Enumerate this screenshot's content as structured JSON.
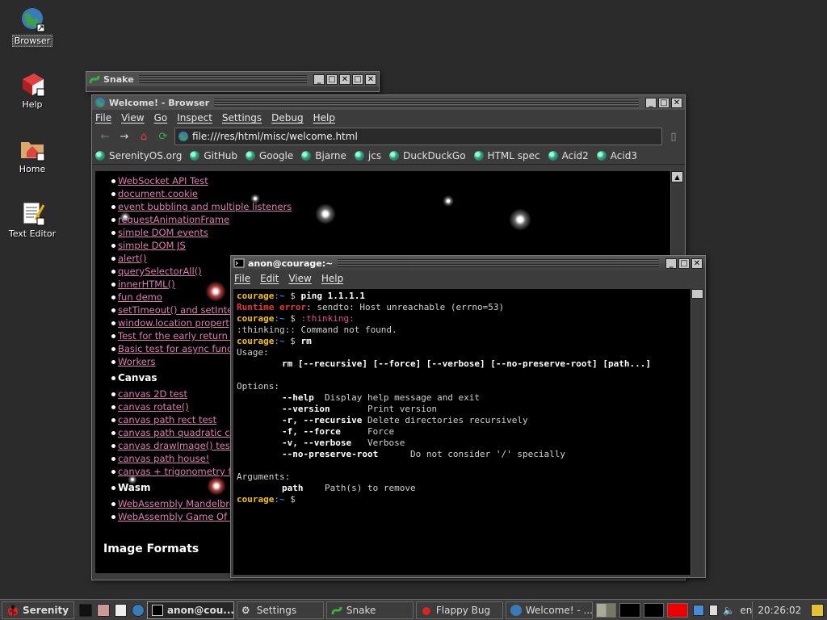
{
  "desktop": {
    "icons": [
      {
        "label": "Browser"
      },
      {
        "label": "Help"
      },
      {
        "label": "Home"
      },
      {
        "label": "Text Editor"
      }
    ]
  },
  "snake_window": {
    "title": "Snake"
  },
  "browser": {
    "title": "Welcome! - Browser",
    "menu": [
      "File",
      "View",
      "Go",
      "Inspect",
      "Settings",
      "Debug",
      "Help"
    ],
    "url": "file:///res/html/misc/welcome.html",
    "bookmarks": [
      "SerenityOS.org",
      "GitHub",
      "Google",
      "Bjarne",
      "jcs",
      "DuckDuckGo",
      "HTML spec",
      "Acid2",
      "Acid3"
    ],
    "links_group1": [
      "WebSocket API Test",
      "document.cookie",
      "event bubbling and multiple listeners",
      "requestAnimationFrame",
      "simple DOM events",
      "simple DOM JS",
      "alert()",
      "querySelectorAll()",
      "innerHTML()",
      "fun demo",
      "setTimeout() and setInter",
      "window.location property",
      "Test for the early return s",
      "Basic test for async func",
      "Workers"
    ],
    "heading_canvas": "Canvas",
    "links_group2": [
      "canvas 2D test",
      "canvas rotate()",
      "canvas path rect test",
      "canvas path quadratic cu",
      "canvas drawImage() test",
      "canvas path house!",
      "canvas + trigonometry fun"
    ],
    "heading_wasm": "Wasm",
    "links_group3": [
      "WebAssembly Mandelbrot",
      "WebAssembly Game Of Li"
    ],
    "heading_image_formats": "Image Formats"
  },
  "terminal": {
    "title": "anon@courage:~",
    "menu": [
      "File",
      "Edit",
      "View",
      "Help"
    ],
    "prompt_user": "courage",
    "prompt_path": ":~",
    "prompt_sym": " $ ",
    "cmd1": "ping 1.1.1.1",
    "err_label": "Runtime error",
    "err_msg": ": sendto: Host unreachable (errno=53)",
    "cmd2": ":thinking:",
    "out2": ":thinking:: Command not found.",
    "cmd3": "rm",
    "usage": "Usage:",
    "usage_line": "rm [--recursive] [--force] [--verbose] [--no-preserve-root] [path...]",
    "options": "Options:",
    "opts": [
      {
        "flag": "--help",
        "desc": "  Display help message and exit"
      },
      {
        "flag": "--version",
        "desc": "       Print version"
      },
      {
        "flag": "-r, --recursive",
        "desc": " Delete directories recursively"
      },
      {
        "flag": "-f, --force",
        "desc": "     Force"
      },
      {
        "flag": "-v, --verbose",
        "desc": "   Verbose"
      },
      {
        "flag": "--no-preserve-root",
        "desc": "      Do not consider '/' specially"
      }
    ],
    "arguments": "Arguments:",
    "arg_name": "path",
    "arg_desc": "    Path(s) to remove"
  },
  "taskbar": {
    "start": "Serenity",
    "tasks": [
      "anon@cou...",
      "Settings",
      "Snake",
      "Flappy Bug",
      "Welcome! - ..."
    ],
    "lang": "en",
    "clock": "20:26:02"
  },
  "colors": {
    "prompt_user": "#f2c200",
    "prompt_path": "#4aa0ff",
    "error": "#e23a3a",
    "link": "#d97fb0"
  }
}
